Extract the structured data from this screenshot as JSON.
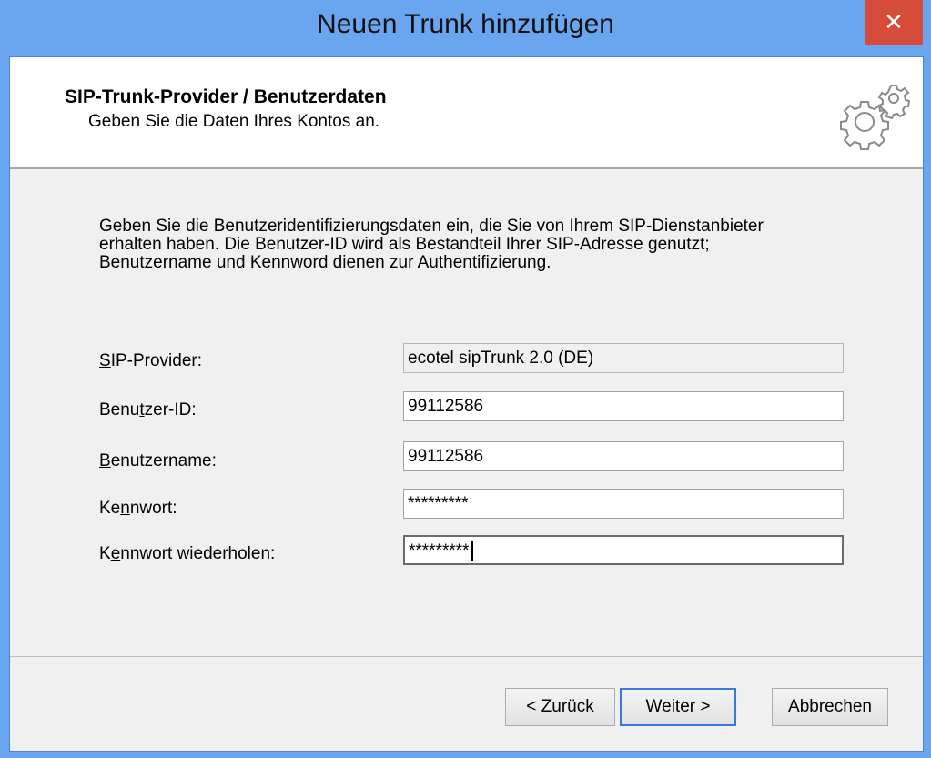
{
  "window": {
    "title": "Neuen Trunk hinzufügen",
    "close_glyph": "✕"
  },
  "header": {
    "title": "SIP-Trunk-Provider / Benutzerdaten",
    "subtitle": "Geben Sie die Daten Ihres Kontos an.",
    "icon": "gears-icon"
  },
  "description": [
    "Geben Sie die Benutzeridentifizierungsdaten ein, die Sie von Ihrem SIP-Dienstanbieter",
    "erhalten haben. Die Benutzer-ID wird als Bestandteil Ihrer SIP-Adresse genutzt;",
    "Benutzername und Kennword dienen zur Authentifizierung."
  ],
  "form": {
    "sip_provider": {
      "label_mnemonic": "S",
      "label_rest": "IP-Provider:",
      "value": "ecotel sipTrunk 2.0 (DE)"
    },
    "user_id": {
      "label_pre": "Benu",
      "label_mnemonic": "t",
      "label_rest": "zer-ID:",
      "value": "99112586"
    },
    "username": {
      "label_mnemonic": "B",
      "label_rest": "enutzername:",
      "value": "99112586"
    },
    "password": {
      "label_pre": "Ke",
      "label_mnemonic": "n",
      "label_rest": "nwort:",
      "value": "*********"
    },
    "password_repeat": {
      "label_pre": "K",
      "label_mnemonic": "e",
      "label_rest": "nnwort wiederholen:",
      "value": "*********"
    }
  },
  "buttons": {
    "back": {
      "pre": "< ",
      "mnemonic": "Z",
      "rest": "urück"
    },
    "next": {
      "mnemonic": "W",
      "rest": "eiter >"
    },
    "cancel": {
      "label": "Abbrechen"
    }
  }
}
